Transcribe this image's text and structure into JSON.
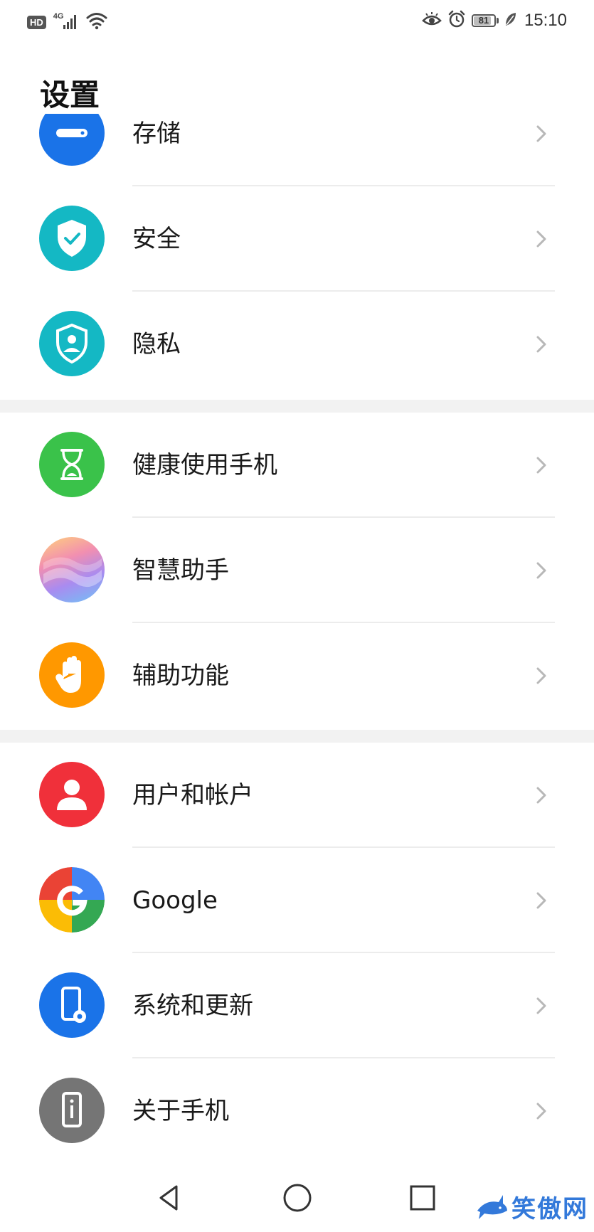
{
  "status_bar": {
    "hd": "HD",
    "network": "4G",
    "battery": "81",
    "battery_level": 0.81,
    "time": "15:10"
  },
  "header": {
    "title": "设置"
  },
  "groups": [
    {
      "items": [
        {
          "label": "存储",
          "icon": "storage-icon",
          "color": "#1a73e8"
        },
        {
          "label": "安全",
          "icon": "shield-check-icon",
          "color": "#14b8c4"
        },
        {
          "label": "隐私",
          "icon": "privacy-shield-icon",
          "color": "#14b8c4"
        }
      ]
    },
    {
      "items": [
        {
          "label": "健康使用手机",
          "icon": "hourglass-icon",
          "color": "#3ac24a"
        },
        {
          "label": "智慧助手",
          "icon": "assistant-icon",
          "color": "#b99be0"
        },
        {
          "label": "辅助功能",
          "icon": "hand-icon",
          "color": "#ff9800"
        }
      ]
    },
    {
      "items": [
        {
          "label": "用户和帐户",
          "icon": "user-icon",
          "color": "#f0303a"
        },
        {
          "label": "Google",
          "icon": "google-icon",
          "color": "#4285f4"
        },
        {
          "label": "系统和更新",
          "icon": "phone-settings-icon",
          "color": "#1a73e8"
        },
        {
          "label": "关于手机",
          "icon": "phone-info-icon",
          "color": "#757575"
        }
      ]
    }
  ],
  "nav": {
    "back_icon": "triangle-back-icon",
    "home_icon": "circle-home-icon",
    "recents_icon": "square-recents-icon"
  },
  "watermark": {
    "text": "笑傲网"
  }
}
